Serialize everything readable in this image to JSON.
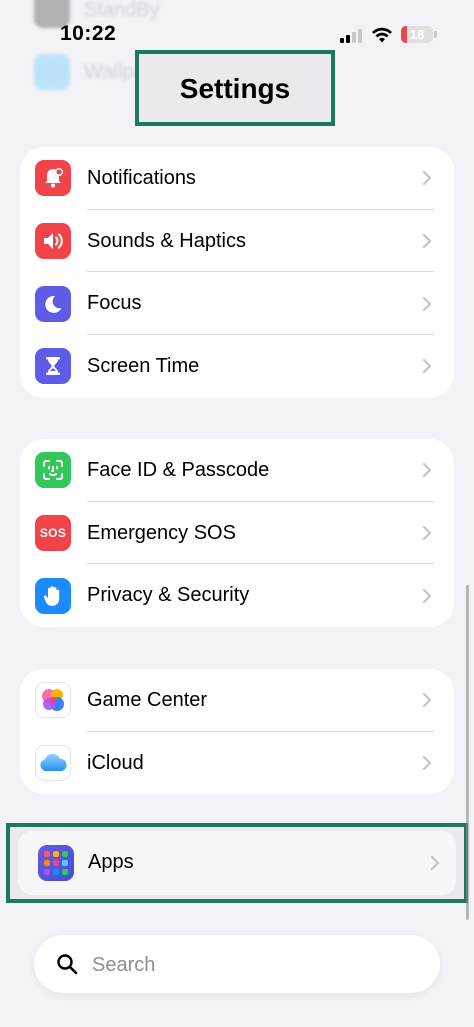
{
  "status_bar": {
    "time": "10:22",
    "battery": "18",
    "battery_color": "#e5484d"
  },
  "background_rows": [
    "StandBy",
    "Wallpaper"
  ],
  "header": {
    "title": "Settings"
  },
  "groups": [
    {
      "items": [
        {
          "label": "Notifications",
          "icon": "bell-icon",
          "color": "#f0434a"
        },
        {
          "label": "Sounds & Haptics",
          "icon": "speaker-icon",
          "color": "#f0434a"
        },
        {
          "label": "Focus",
          "icon": "moon-icon",
          "color": "#5e5ce6"
        },
        {
          "label": "Screen Time",
          "icon": "hourglass-icon",
          "color": "#5e5ce6"
        }
      ]
    },
    {
      "items": [
        {
          "label": "Face ID & Passcode",
          "icon": "faceid-icon",
          "color": "#34c759"
        },
        {
          "label": "Emergency SOS",
          "icon": "sos-icon",
          "color": "#f0434a",
          "badge": "SOS"
        },
        {
          "label": "Privacy & Security",
          "icon": "hand-icon",
          "color": "#1a8cff"
        }
      ]
    },
    {
      "items": [
        {
          "label": "Game Center",
          "icon": "game-center-icon",
          "color": "#ffffff"
        },
        {
          "label": "iCloud",
          "icon": "cloud-icon",
          "color": "#ffffff"
        }
      ]
    }
  ],
  "apps": {
    "label": "Apps",
    "icon": "apps-grid-icon"
  },
  "search": {
    "placeholder": "Search"
  },
  "accent": "#197a5f"
}
